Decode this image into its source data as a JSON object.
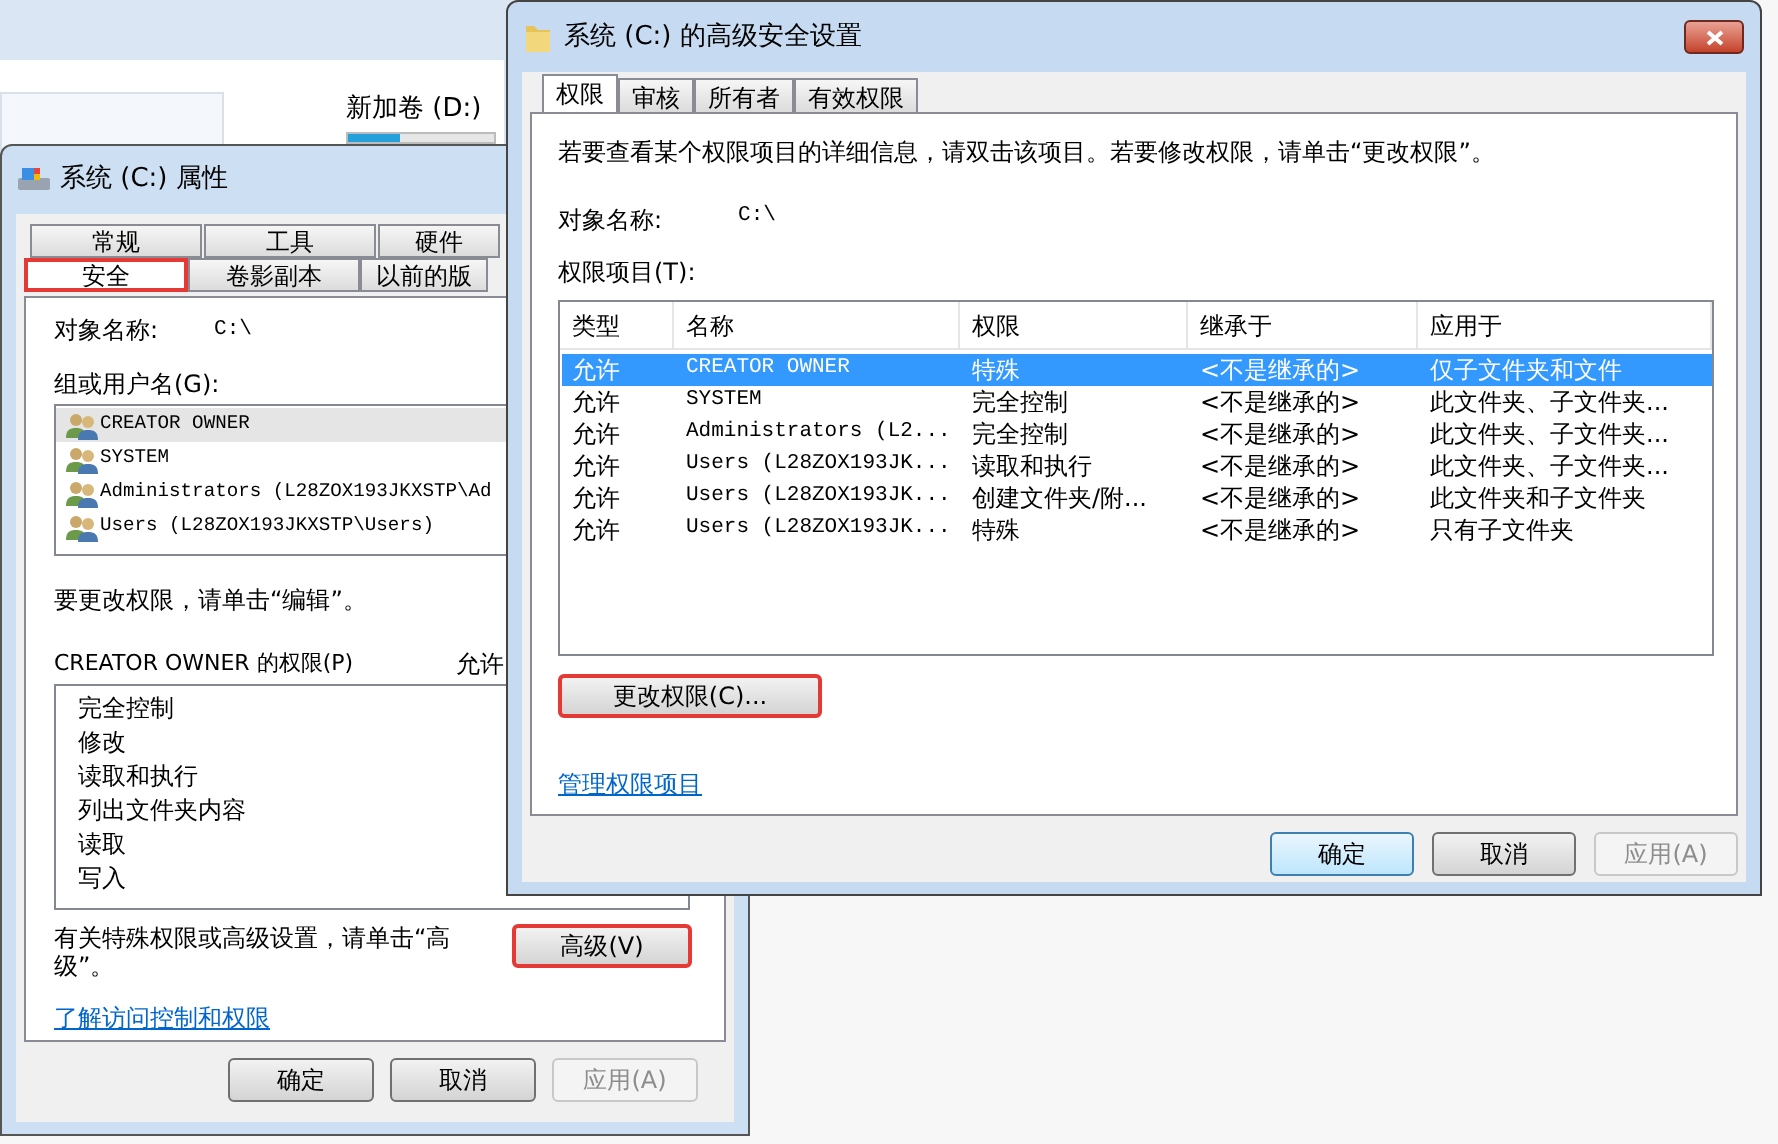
{
  "background_window": {
    "drive": {
      "label": "新加卷 (D:)",
      "level": 0.35
    }
  },
  "properties_window": {
    "title": "系统 (C:) 属性",
    "tab_rows": [
      [
        {
          "label": "常规",
          "selected": false,
          "highlighted": false
        },
        {
          "label": "工具",
          "selected": false,
          "highlighted": false
        },
        {
          "label": "硬件",
          "selected": false,
          "highlighted": false
        }
      ],
      [
        {
          "label": "安全",
          "selected": true,
          "highlighted": true
        },
        {
          "label": "卷影副本",
          "selected": false,
          "highlighted": false
        },
        {
          "label": "以前的版",
          "selected": false,
          "highlighted": false
        }
      ]
    ],
    "object_label": "对象名称:",
    "object_value": "C:\\",
    "groups_label": "组或用户名(G):",
    "groups": [
      {
        "name": "CREATOR OWNER",
        "selected": true
      },
      {
        "name": "SYSTEM",
        "selected": false
      },
      {
        "name": "Administrators (L28ZOX193JKXSTP\\Ad",
        "selected": false
      },
      {
        "name": "Users (L28ZOX193JKXSTP\\Users)",
        "selected": false
      }
    ],
    "edit_hint": "要更改权限，请单击“编辑”。",
    "permissions_label": "CREATOR OWNER 的权限(P)",
    "allow_header": "允许",
    "permissions": [
      "完全控制",
      "修改",
      "读取和执行",
      "列出文件夹内容",
      "读取",
      "写入"
    ],
    "advanced_hint": "有关特殊权限或高级设置，请单击“高级”。",
    "advanced_button": {
      "label": "高级(V)",
      "highlighted": true
    },
    "link": "了解访问控制和权限",
    "buttons": [
      {
        "label": "确定",
        "disabled": false
      },
      {
        "label": "取消",
        "disabled": false
      },
      {
        "label": "应用(A)",
        "disabled": true
      }
    ]
  },
  "advanced_window": {
    "title": "系统 (C:) 的高级安全设置",
    "tabs": [
      {
        "label": "权限",
        "selected": true
      },
      {
        "label": "审核",
        "selected": false
      },
      {
        "label": "所有者",
        "selected": false
      },
      {
        "label": "有效权限",
        "selected": false
      }
    ],
    "instructions": "若要查看某个权限项目的详细信息，请双击该项目。若要修改权限，请单击“更改权限”。",
    "object_label": "对象名称:",
    "object_value": "C:\\",
    "entries_label": "权限项目(T):",
    "table": {
      "columns": [
        "类型",
        "名称",
        "权限",
        "继承于",
        "应用于"
      ],
      "rows": [
        {
          "cells": [
            "允许",
            "CREATOR OWNER",
            "特殊",
            "<不是继承的>",
            "仅子文件夹和文件"
          ],
          "selected": true
        },
        {
          "cells": [
            "允许",
            "SYSTEM",
            "完全控制",
            "<不是继承的>",
            "此文件夹、子文件夹..."
          ],
          "selected": false
        },
        {
          "cells": [
            "允许",
            "Administrators (L2...",
            "完全控制",
            "<不是继承的>",
            "此文件夹、子文件夹..."
          ],
          "selected": false
        },
        {
          "cells": [
            "允许",
            "Users (L28ZOX193JK...",
            "读取和执行",
            "<不是继承的>",
            "此文件夹、子文件夹..."
          ],
          "selected": false
        },
        {
          "cells": [
            "允许",
            "Users (L28ZOX193JK...",
            "创建文件夹/附...",
            "<不是继承的>",
            "此文件夹和子文件夹"
          ],
          "selected": false
        },
        {
          "cells": [
            "允许",
            "Users (L28ZOX193JK...",
            "特殊",
            "<不是继承的>",
            "只有子文件夹"
          ],
          "selected": false
        }
      ]
    },
    "change_button": {
      "label": "更改权限(C)...",
      "highlighted": true
    },
    "link": "管理权限项目",
    "buttons": [
      {
        "label": "确定",
        "default": true,
        "disabled": false
      },
      {
        "label": "取消",
        "default": false,
        "disabled": false
      },
      {
        "label": "应用(A)",
        "default": false,
        "disabled": true
      }
    ]
  }
}
